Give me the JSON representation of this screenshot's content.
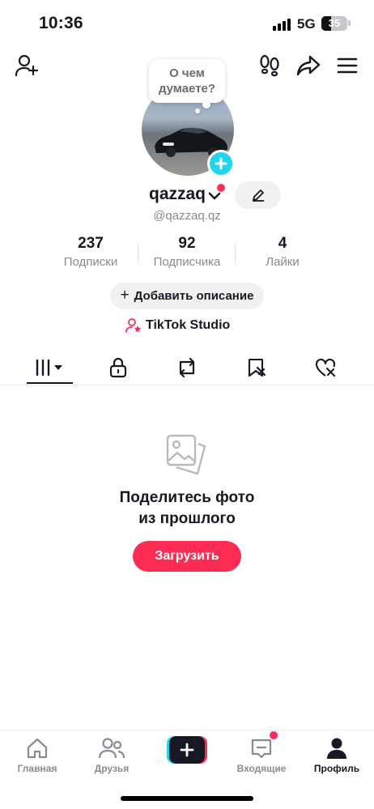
{
  "status_bar": {
    "time": "10:36",
    "network": "5G",
    "battery": "35"
  },
  "bubble": {
    "line1": "О чем",
    "line2": "думаете?"
  },
  "profile": {
    "username": "qazzaq",
    "handle": "@qazzaq.qz"
  },
  "stats": [
    {
      "value": "237",
      "label": "Подписки"
    },
    {
      "value": "92",
      "label": "Подписчика"
    },
    {
      "value": "4",
      "label": "Лайки"
    }
  ],
  "add_description": {
    "plus": "+",
    "label": "Добавить описание"
  },
  "studio": {
    "label": "TikTok Studio"
  },
  "empty_state": {
    "line1": "Поделитесь фото",
    "line2": "из прошлого",
    "button": "Загрузить"
  },
  "bottom_nav": [
    {
      "label": "Главная"
    },
    {
      "label": "Друзья"
    },
    {
      "label": "Входящие"
    },
    {
      "label": "Профиль"
    }
  ],
  "icons": {
    "top_left": "add-friend-icon",
    "top_right": [
      "footprints-icon",
      "share-icon",
      "menu-icon"
    ],
    "tabs": [
      "grid-icon",
      "lock-icon",
      "repost-icon",
      "favorites-icon",
      "liked-icon"
    ]
  },
  "colors": {
    "accent": "#fe2c55",
    "cyan": "#20d5ec",
    "text": "#161823",
    "muted": "#8a8b91"
  }
}
